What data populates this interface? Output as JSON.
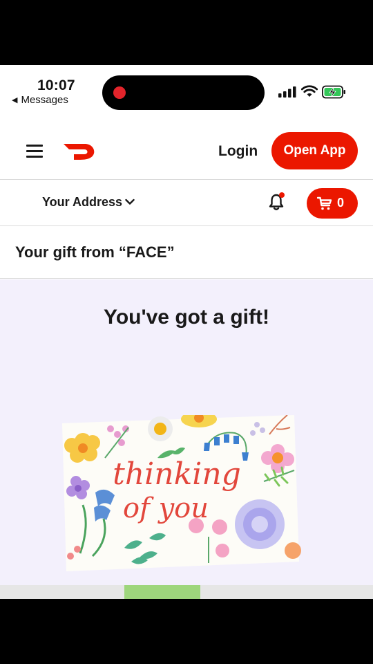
{
  "status_bar": {
    "time": "10:07",
    "back_app": "Messages",
    "icons": [
      "signal-icon",
      "wifi-icon",
      "battery-charging-icon"
    ],
    "recording_color": "#e3242b"
  },
  "header": {
    "logo": "doordash-logo",
    "login_label": "Login",
    "open_app_label": "Open App"
  },
  "address_bar": {
    "address_label": "Your Address",
    "notification_icon": "bell-icon",
    "cart_count": "0"
  },
  "gift": {
    "page_title": "Your gift from “FACE”",
    "headline": "You've got a gift!",
    "card_text_line1": "thinking",
    "card_text_line2": "of you"
  },
  "colors": {
    "brand_red": "#eb1700",
    "content_bg": "#f3f0fc"
  }
}
